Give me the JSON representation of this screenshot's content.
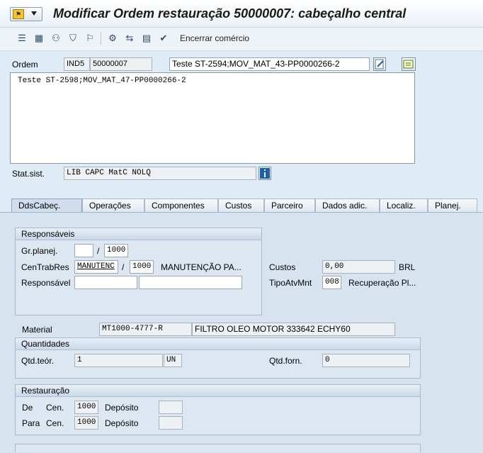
{
  "window": {
    "title": "Modificar Ordem restauração 50000007: cabeçalho central"
  },
  "toolbar": {
    "icons": [
      "list-icon",
      "calculator-icon",
      "people-icon",
      "hat-icon",
      "flag-icon",
      "material-icon",
      "move-icon",
      "document-icon",
      "check-icon"
    ],
    "end_commerce_label": "Encerrar comércio"
  },
  "header": {
    "order_label": "Ordem",
    "order_type": "IND5",
    "order_number": "50000007",
    "order_desc": "Teste ST-2594;MOV_MAT_43-PP0000266-2",
    "long_text": "Teste ST-2598;MOV_MAT_47-PP0000266-2",
    "status_label": "Stat.sist.",
    "status_value": "LIB  CAPC MatC NOLQ"
  },
  "tabs": [
    "DdsCabeç.",
    "Operações",
    "Componentes",
    "Custos",
    "Parceiro",
    "Dados adic.",
    "Localiz.",
    "Planej."
  ],
  "responsaveis": {
    "title": "Responsáveis",
    "planner_group_label": "Gr.planej.",
    "planner_group_value": "",
    "planner_group_plant": "1000",
    "workcenter_label": "CenTrabRes",
    "workcenter_value": "MANUTENC",
    "workcenter_plant": "1000",
    "workcenter_desc": "MANUTENÇÃO PA...",
    "responsible_label": "Responsável",
    "responsible_value": "",
    "responsible_value2": ""
  },
  "costs": {
    "label": "Custos",
    "value": "0,00",
    "currency": "BRL",
    "activity_label": "TipoAtvMnt",
    "activity_value": "008",
    "activity_desc": "Recuperação Pl..."
  },
  "material": {
    "label": "Material",
    "value": "MT1000-4777-R",
    "desc": "FILTRO OLEO MOTOR 333642 ECHY60"
  },
  "quantidades": {
    "title": "Quantidades",
    "theoretical_label": "Qtd.teór.",
    "theoretical_value": "1",
    "unit": "UN",
    "supplied_label": "Qtd.forn.",
    "supplied_value": "0"
  },
  "restauracao": {
    "title": "Restauração",
    "from_label": "De",
    "to_label": "Para",
    "plant_label": "Cen.",
    "from_plant": "1000",
    "to_plant": "1000",
    "storage_label": "Depósito",
    "from_storage": "",
    "to_storage": ""
  }
}
